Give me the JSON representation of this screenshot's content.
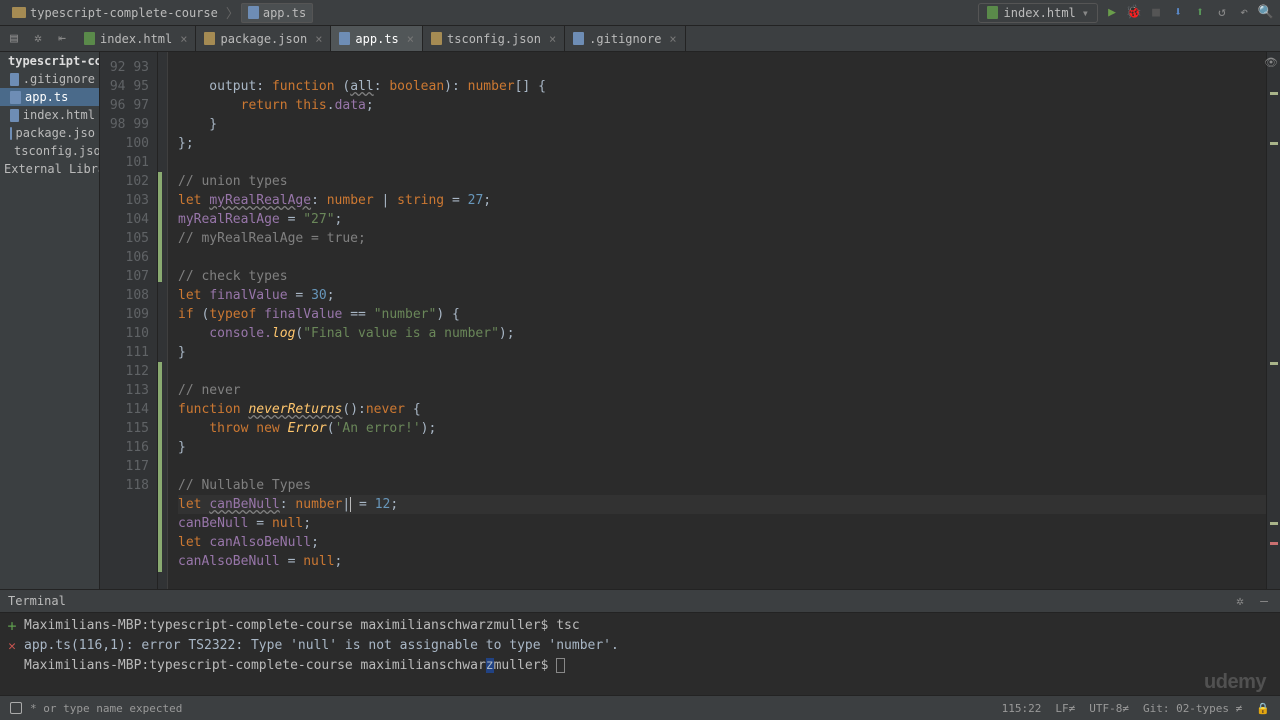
{
  "breadcrumb": {
    "project": "typescript-complete-course",
    "file": "app.ts"
  },
  "runconfig": "index.html",
  "tabs": [
    {
      "name": "index.html",
      "active": false
    },
    {
      "name": "package.json",
      "active": false
    },
    {
      "name": "app.ts",
      "active": true
    },
    {
      "name": "tsconfig.json",
      "active": false
    },
    {
      "name": ".gitignore",
      "active": false
    }
  ],
  "project": {
    "root": "typescript-com",
    "files": [
      ".gitignore",
      "app.ts",
      "index.html",
      "package.jso",
      "tsconfig.json"
    ],
    "selected": "app.ts",
    "libs": "External Librarie"
  },
  "lines_start": 92,
  "lines_end": 118,
  "code_tokens": [
    [],
    [
      [
        "    output",
        ""
      ],
      [
        ": ",
        "c-op"
      ],
      [
        "function ",
        "c-kw"
      ],
      [
        "(",
        ""
      ],
      [
        "all",
        "c-warn"
      ],
      [
        ": ",
        "c-op"
      ],
      [
        "boolean",
        "c-kw"
      ],
      [
        "): ",
        "c-op"
      ],
      [
        "number",
        "c-kw"
      ],
      [
        "[] {",
        ""
      ]
    ],
    [
      [
        "        ",
        ""
      ],
      [
        "return ",
        "c-kw"
      ],
      [
        "this",
        "c-kw"
      ],
      [
        ".",
        "c-op"
      ],
      [
        "data",
        "c-id"
      ],
      [
        ";",
        ""
      ]
    ],
    [
      [
        "    }",
        ""
      ]
    ],
    [
      [
        "};",
        ""
      ]
    ],
    [],
    [
      [
        "// union types",
        "c-cmt"
      ]
    ],
    [
      [
        "let ",
        "c-kw"
      ],
      [
        "myRealRealAge",
        "c-id c-warn"
      ],
      [
        ": ",
        "c-op"
      ],
      [
        "number ",
        "c-kw"
      ],
      [
        "| ",
        "c-op"
      ],
      [
        "string ",
        "c-kw"
      ],
      [
        "= ",
        "c-op"
      ],
      [
        "27",
        "c-num"
      ],
      [
        ";",
        ""
      ]
    ],
    [
      [
        "myRealRealAge",
        "c-id"
      ],
      [
        " = ",
        "c-op"
      ],
      [
        "\"27\"",
        "c-str"
      ],
      [
        ";",
        ""
      ]
    ],
    [
      [
        "// myRealRealAge = true;",
        "c-cmt"
      ]
    ],
    [],
    [
      [
        "// check types",
        "c-cmt"
      ]
    ],
    [
      [
        "let ",
        "c-kw"
      ],
      [
        "finalValue",
        "c-id"
      ],
      [
        " = ",
        "c-op"
      ],
      [
        "30",
        "c-num"
      ],
      [
        ";",
        ""
      ]
    ],
    [
      [
        "if ",
        "c-kw"
      ],
      [
        "(",
        "c-op"
      ],
      [
        "typeof ",
        "c-kw"
      ],
      [
        "finalValue",
        "c-id"
      ],
      [
        " == ",
        "c-op"
      ],
      [
        "\"number\"",
        "c-str"
      ],
      [
        ") {",
        ""
      ]
    ],
    [
      [
        "    console.",
        "c-id"
      ],
      [
        "log",
        "c-fn"
      ],
      [
        "(",
        "c-op"
      ],
      [
        "\"Final value is a number\"",
        "c-str"
      ],
      [
        ");",
        ""
      ]
    ],
    [
      [
        "}",
        ""
      ]
    ],
    [],
    [
      [
        "// never",
        "c-cmt"
      ]
    ],
    [
      [
        "function ",
        "c-kw"
      ],
      [
        "neverReturns",
        "c-fn c-warn"
      ],
      [
        "():",
        "c-op"
      ],
      [
        "never ",
        "c-kw"
      ],
      [
        "{",
        ""
      ]
    ],
    [
      [
        "    ",
        ""
      ],
      [
        "throw new ",
        "c-kw"
      ],
      [
        "Error",
        "c-fn"
      ],
      [
        "(",
        "c-op"
      ],
      [
        "'An error!'",
        "c-str"
      ],
      [
        ");",
        ""
      ]
    ],
    [
      [
        "}",
        ""
      ]
    ],
    [],
    [
      [
        "// Nullable Types",
        "c-cmt"
      ]
    ],
    [
      [
        "let ",
        "c-kw"
      ],
      [
        "canBeNull",
        "c-id c-warn"
      ],
      [
        ": ",
        "c-op"
      ],
      [
        "number",
        "c-kw"
      ],
      [
        "|",
        "caret"
      ],
      [
        " = ",
        "c-op"
      ],
      [
        "12",
        "c-num"
      ],
      [
        ";",
        ""
      ]
    ],
    [
      [
        "canBeNull",
        "c-id"
      ],
      [
        " = ",
        "c-op"
      ],
      [
        "null",
        "c-kw"
      ],
      [
        ";",
        ""
      ]
    ],
    [
      [
        "let ",
        "c-kw"
      ],
      [
        "canAlsoBeNull",
        "c-id"
      ],
      [
        ";",
        ""
      ]
    ],
    [
      [
        "canAlsoBeNull",
        "c-id"
      ],
      [
        " = ",
        "c-op"
      ],
      [
        "null",
        "c-kw"
      ],
      [
        ";",
        ""
      ]
    ]
  ],
  "terminal": {
    "title": "Terminal",
    "l1_prompt": "Maximilians-MBP:typescript-complete-course maximilianschwarzmuller$ ",
    "l1_cmd": "tsc",
    "l2": "app.ts(116,1): error TS2322: Type 'null' is not assignable to type 'number'.",
    "l3_prompt": "Maximilians-MBP:typescript-complete-course maximilianschwar",
    "l3_tail": "muller$ ",
    "l3_hl": "z"
  },
  "status": {
    "msg": "* or type name expected",
    "pos": "115:22",
    "le": "LF≠",
    "enc": "UTF-8≠",
    "git": "Git: 02-types ≠",
    "lock": "🔒"
  },
  "watermark": "udemy"
}
